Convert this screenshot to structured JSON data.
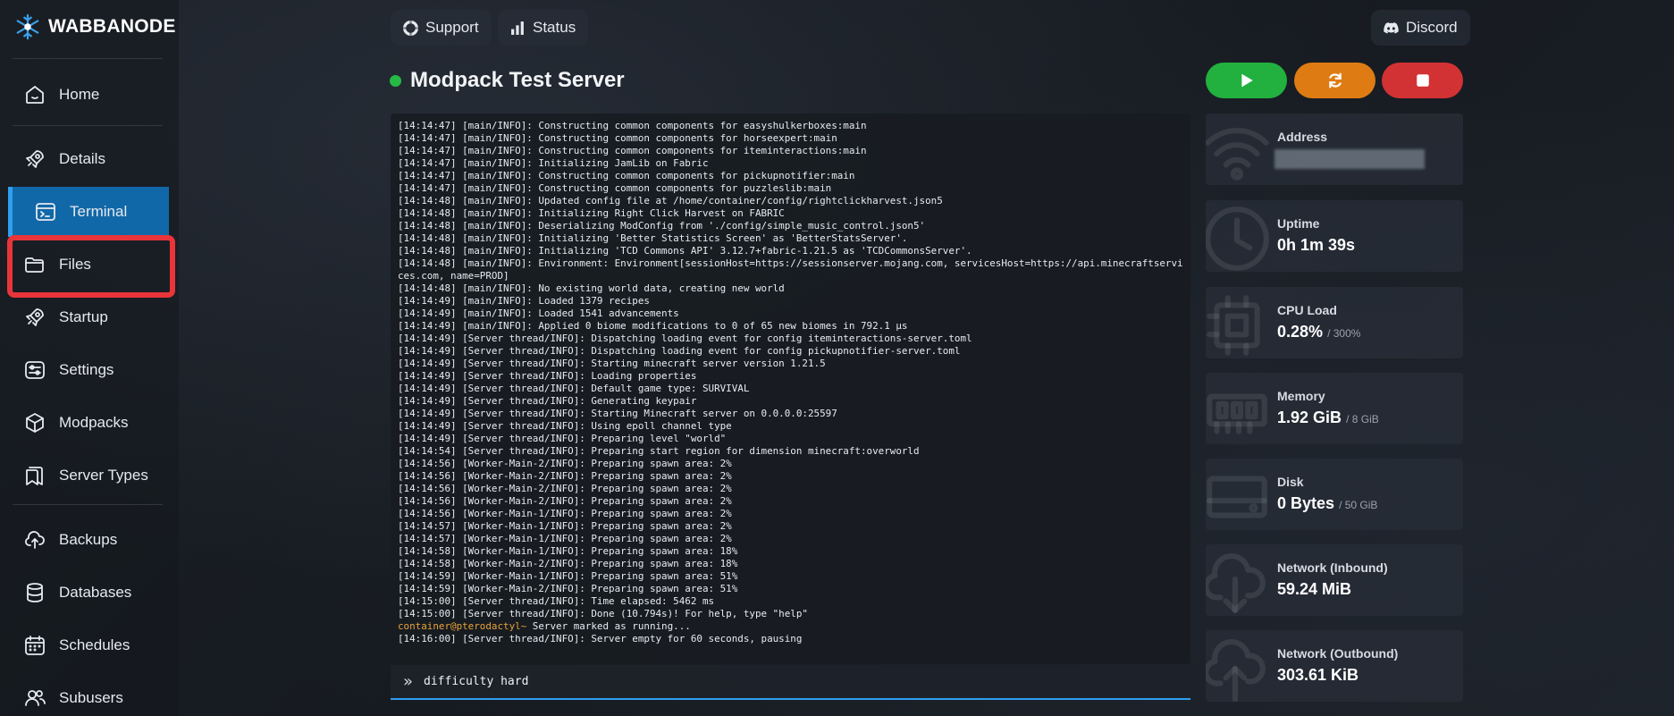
{
  "brand": {
    "name": "WABBANODE"
  },
  "sidebar": {
    "items": [
      {
        "label": "Home",
        "icon": "home-icon"
      },
      {
        "label": "Details",
        "icon": "rocket-icon"
      },
      {
        "label": "Terminal",
        "icon": "terminal-icon",
        "active": true
      },
      {
        "label": "Files",
        "icon": "folder-icon",
        "highlighted": true
      },
      {
        "label": "Startup",
        "icon": "rocket-icon"
      },
      {
        "label": "Settings",
        "icon": "sliders-icon"
      },
      {
        "label": "Modpacks",
        "icon": "cube-icon"
      },
      {
        "label": "Server Types",
        "icon": "bookmark-icon"
      },
      {
        "label": "Backups",
        "icon": "cloud-upload-icon"
      },
      {
        "label": "Databases",
        "icon": "database-icon"
      },
      {
        "label": "Schedules",
        "icon": "calendar-icon"
      },
      {
        "label": "Subusers",
        "icon": "users-icon"
      }
    ]
  },
  "topbar": {
    "support_label": "Support",
    "status_label": "Status",
    "discord_label": "Discord"
  },
  "server": {
    "title": "Modpack Test Server",
    "status_color": "#27b845"
  },
  "power": {
    "start_color": "#22b13e",
    "restart_color": "#de7c13",
    "stop_color": "#d33234"
  },
  "console": {
    "lines": [
      "[14:14:47] [main/INFO]: Constructing common components for easyshulkerboxes:main",
      "[14:14:47] [main/INFO]: Constructing common components for horseexpert:main",
      "[14:14:47] [main/INFO]: Constructing common components for iteminteractions:main",
      "[14:14:47] [main/INFO]: Initializing JamLib on Fabric",
      "[14:14:47] [main/INFO]: Constructing common components for pickupnotifier:main",
      "[14:14:47] [main/INFO]: Constructing common components for puzzleslib:main",
      "[14:14:48] [main/INFO]: Updated config file at /home/container/config/rightclickharvest.json5",
      "[14:14:48] [main/INFO]: Initializing Right Click Harvest on FABRIC",
      "[14:14:48] [main/INFO]: Deserializing ModConfig from './config/simple_music_control.json5'",
      "[14:14:48] [main/INFO]: Initializing 'Better Statistics Screen' as 'BetterStatsServer'.",
      "[14:14:48] [main/INFO]: Initializing 'TCD Commons API' 3.12.7+fabric-1.21.5 as 'TCDCommonsServer'.",
      "[14:14:48] [main/INFO]: Environment: Environment[sessionHost=https://sessionserver.mojang.com, servicesHost=https://api.minecraftservices.com, name=PROD]",
      "[14:14:48] [main/INFO]: No existing world data, creating new world",
      "[14:14:49] [main/INFO]: Loaded 1379 recipes",
      "[14:14:49] [main/INFO]: Loaded 1541 advancements",
      "[14:14:49] [main/INFO]: Applied 0 biome modifications to 0 of 65 new biomes in 792.1 µs",
      "[14:14:49] [Server thread/INFO]: Dispatching loading event for config iteminteractions-server.toml",
      "[14:14:49] [Server thread/INFO]: Dispatching loading event for config pickupnotifier-server.toml",
      "[14:14:49] [Server thread/INFO]: Starting minecraft server version 1.21.5",
      "[14:14:49] [Server thread/INFO]: Loading properties",
      "[14:14:49] [Server thread/INFO]: Default game type: SURVIVAL",
      "[14:14:49] [Server thread/INFO]: Generating keypair",
      "[14:14:49] [Server thread/INFO]: Starting Minecraft server on 0.0.0.0:25597",
      "[14:14:49] [Server thread/INFO]: Using epoll channel type",
      "[14:14:49] [Server thread/INFO]: Preparing level \"world\"",
      "[14:14:54] [Server thread/INFO]: Preparing start region for dimension minecraft:overworld",
      "[14:14:56] [Worker-Main-2/INFO]: Preparing spawn area: 2%",
      "[14:14:56] [Worker-Main-2/INFO]: Preparing spawn area: 2%",
      "[14:14:56] [Worker-Main-2/INFO]: Preparing spawn area: 2%",
      "[14:14:56] [Worker-Main-2/INFO]: Preparing spawn area: 2%",
      "[14:14:56] [Worker-Main-1/INFO]: Preparing spawn area: 2%",
      "[14:14:57] [Worker-Main-1/INFO]: Preparing spawn area: 2%",
      "[14:14:57] [Worker-Main-1/INFO]: Preparing spawn area: 2%",
      "[14:14:58] [Worker-Main-1/INFO]: Preparing spawn area: 18%",
      "[14:14:58] [Worker-Main-2/INFO]: Preparing spawn area: 18%",
      "[14:14:59] [Worker-Main-1/INFO]: Preparing spawn area: 51%",
      "[14:14:59] [Worker-Main-2/INFO]: Preparing spawn area: 51%",
      "[14:15:00] [Server thread/INFO]: Time elapsed: 5462 ms",
      "[14:15:00] [Server thread/INFO]: Done (10.794s)! For help, type \"help\"",
      "Server marked as running...",
      "[14:16:00] [Server thread/INFO]: Server empty for 60 seconds, pausing"
    ],
    "prompt_line_index": 39,
    "prompt_prefix": "container@pterodactyl~",
    "input_value": "difficulty hard"
  },
  "stats": [
    {
      "label": "Address",
      "value": "",
      "unit": "",
      "icon": "wifi-icon",
      "redacted": true
    },
    {
      "label": "Uptime",
      "value": "0h 1m 39s",
      "unit": "",
      "icon": "clock-icon"
    },
    {
      "label": "CPU Load",
      "value": "0.28%",
      "unit": "/ 300%",
      "icon": "cpu-icon"
    },
    {
      "label": "Memory",
      "value": "1.92 GiB",
      "unit": "/ 8 GiB",
      "icon": "memory-icon"
    },
    {
      "label": "Disk",
      "value": "0 Bytes",
      "unit": "/ 50 GiB",
      "icon": "disk-icon"
    },
    {
      "label": "Network (Inbound)",
      "value": "59.24 MiB",
      "unit": "",
      "icon": "cloud-download-icon"
    },
    {
      "label": "Network (Outbound)",
      "value": "303.61 KiB",
      "unit": "",
      "icon": "cloud-upload-icon"
    }
  ]
}
